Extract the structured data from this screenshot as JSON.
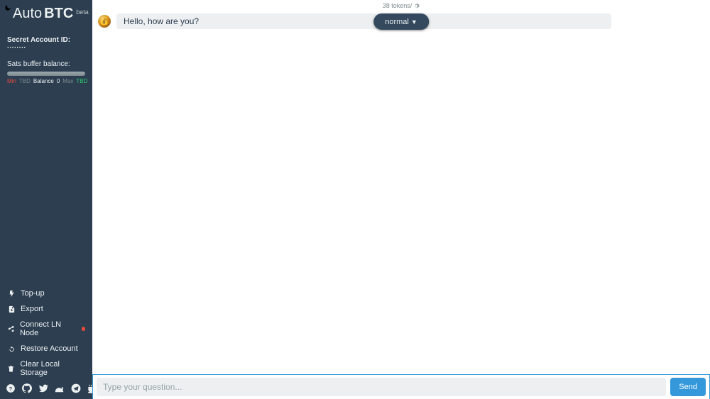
{
  "brand": {
    "part1": "Auto",
    "part2": "BTC",
    "badge": "beta"
  },
  "account": {
    "id_label": "Secret Account ID: ",
    "id_masked": "········",
    "buffer_label": "Sats buffer balance:",
    "stat_min": "Min",
    "stat_tbd": "TBD",
    "stat_bal_label": "Balance",
    "stat_bal_val": "0",
    "stat_max": "Max",
    "stat_tbd2": "TBD"
  },
  "menu": {
    "topup": "Top-up",
    "export": "Export",
    "connect": "Connect LN Node",
    "restore": "Restore Account",
    "clear": "Clear Local Storage"
  },
  "social_icons": [
    "help",
    "github",
    "twitter",
    "nostr",
    "telegram",
    "coffee"
  ],
  "header": {
    "tokens_text": "38 tokens/"
  },
  "mode": {
    "label": "normal",
    "caret": "▼"
  },
  "messages": [
    {
      "role": "user",
      "text": "Hello, how are you?"
    }
  ],
  "composer": {
    "placeholder": "Type your question...",
    "send": "Send"
  }
}
